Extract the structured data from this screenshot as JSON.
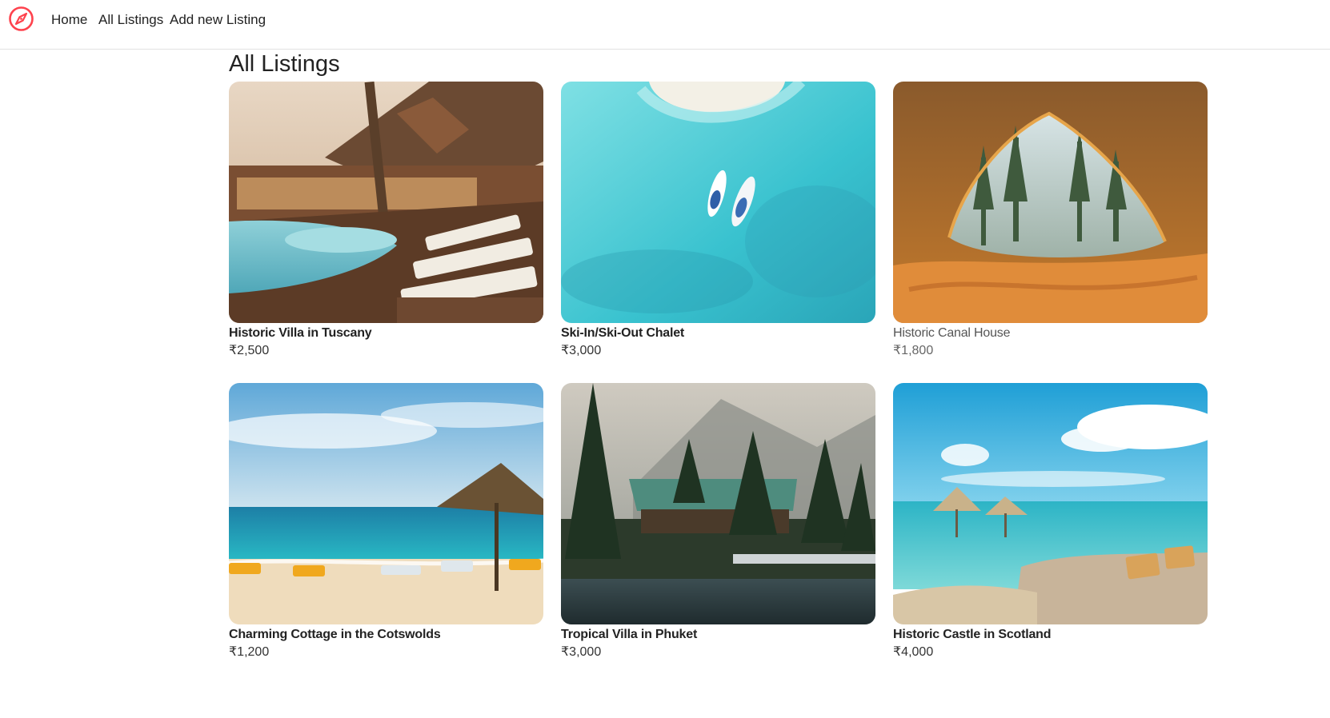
{
  "nav": {
    "brand_icon": "compass-icon",
    "brand_color": "#fe424d",
    "links": [
      "Home",
      "All Listings",
      "Add new Listing"
    ]
  },
  "page": {
    "title": "All Listings"
  },
  "listings": [
    {
      "title": "Historic Villa in Tuscany",
      "price": "₹2,500"
    },
    {
      "title": "Ski-In/Ski-Out Chalet",
      "price": "₹3,000"
    },
    {
      "title": "Historic Canal House",
      "price": "₹1,800"
    },
    {
      "title": "Charming Cottage in the Cotswolds",
      "price": "₹1,200"
    },
    {
      "title": "Tropical Villa in Phuket",
      "price": "₹3,000"
    },
    {
      "title": "Historic Castle in Scotland",
      "price": "₹4,000"
    }
  ]
}
